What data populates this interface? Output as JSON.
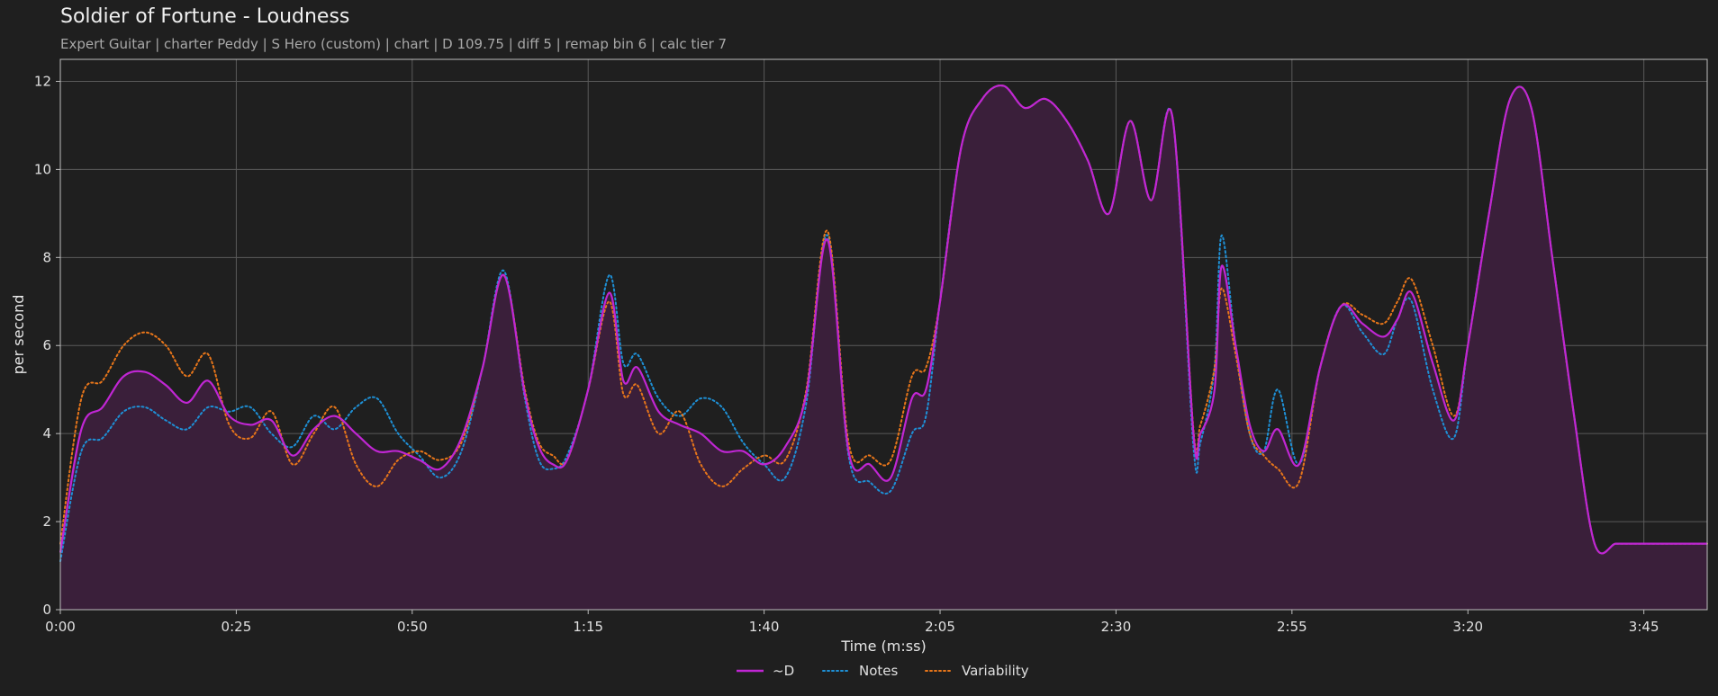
{
  "chart_data": {
    "type": "line",
    "title": "Soldier of Fortune - Loudness",
    "subtitle": "Expert Guitar  |  charter Peddy  |  S Hero (custom)  |  chart  |  D 109.75  |  diff 5  |  remap bin 6  |  calc tier 7",
    "xlabel": "Time (m:ss)",
    "ylabel": "per second",
    "xlim": [
      0,
      234
    ],
    "ylim": [
      0,
      12.5
    ],
    "xticks": [
      {
        "value": 0,
        "label": "0:00"
      },
      {
        "value": 25,
        "label": "0:25"
      },
      {
        "value": 50,
        "label": "0:50"
      },
      {
        "value": 75,
        "label": "1:15"
      },
      {
        "value": 100,
        "label": "1:40"
      },
      {
        "value": 125,
        "label": "2:05"
      },
      {
        "value": 150,
        "label": "2:30"
      },
      {
        "value": 175,
        "label": "2:55"
      },
      {
        "value": 200,
        "label": "3:20"
      },
      {
        "value": 225,
        "label": "3:45"
      }
    ],
    "yticks": [
      {
        "value": 0,
        "label": "0"
      },
      {
        "value": 2,
        "label": "2"
      },
      {
        "value": 4,
        "label": "4"
      },
      {
        "value": 6,
        "label": "6"
      },
      {
        "value": 8,
        "label": "8"
      },
      {
        "value": 10,
        "label": "10"
      },
      {
        "value": 12,
        "label": "12"
      }
    ],
    "grid": true,
    "legend_position": "bottom-center",
    "x": [
      0,
      3,
      6,
      9,
      12,
      15,
      18,
      21,
      24,
      27,
      30,
      33,
      36,
      39,
      42,
      45,
      48,
      51,
      54,
      57,
      60,
      63,
      66,
      68,
      70,
      72,
      75,
      78,
      80,
      82,
      85,
      88,
      91,
      94,
      97,
      100,
      103,
      106,
      109,
      112,
      115,
      118,
      121,
      123,
      125,
      128,
      131,
      134,
      137,
      140,
      143,
      146,
      149,
      152,
      155,
      158,
      161,
      162,
      164,
      165,
      167,
      169,
      171,
      173,
      176,
      179,
      182,
      185,
      188,
      190,
      192,
      195,
      198,
      200,
      203,
      206,
      209,
      212,
      215,
      218,
      221,
      223,
      226,
      229,
      232,
      234
    ],
    "series": [
      {
        "name": "~D",
        "color": "#c026d3",
        "style": "solid",
        "values": [
          1.3,
          4.1,
          4.6,
          5.3,
          5.4,
          5.1,
          4.7,
          5.2,
          4.4,
          4.2,
          4.3,
          3.5,
          4.1,
          4.4,
          4.0,
          3.6,
          3.6,
          3.4,
          3.2,
          3.9,
          5.5,
          7.6,
          4.9,
          3.7,
          3.3,
          3.4,
          5.0,
          7.2,
          5.2,
          5.5,
          4.5,
          4.2,
          4.0,
          3.6,
          3.6,
          3.3,
          3.7,
          4.9,
          8.4,
          3.6,
          3.3,
          3.0,
          4.8,
          5.0,
          7.0,
          10.5,
          11.6,
          11.9,
          11.4,
          11.6,
          11.1,
          10.2,
          9.0,
          11.1,
          9.3,
          11.2,
          4.0,
          4.0,
          5.0,
          7.8,
          6.0,
          4.2,
          3.6,
          4.1,
          3.3,
          5.5,
          6.9,
          6.5,
          6.2,
          6.6,
          7.2,
          5.6,
          4.3,
          6.0,
          9.0,
          11.6,
          11.4,
          8.0,
          4.5,
          1.5,
          1.5,
          1.5,
          1.5,
          1.5,
          1.5,
          1.5
        ]
      },
      {
        "name": "Notes",
        "color": "#1e90d6",
        "style": "dotted",
        "values": [
          1.1,
          3.6,
          3.9,
          4.5,
          4.6,
          4.3,
          4.1,
          4.6,
          4.5,
          4.6,
          4.0,
          3.7,
          4.4,
          4.1,
          4.6,
          4.8,
          4.0,
          3.5,
          3.0,
          3.6,
          5.5,
          7.7,
          4.8,
          3.4,
          3.2,
          3.5,
          5.0,
          7.6,
          5.6,
          5.8,
          4.8,
          4.4,
          4.8,
          4.6,
          3.8,
          3.3,
          3.0,
          4.7,
          8.5,
          3.5,
          2.9,
          2.7,
          4.0,
          4.4,
          7.0,
          10.5,
          11.6,
          11.9,
          11.4,
          11.6,
          11.1,
          10.2,
          9.0,
          11.1,
          9.3,
          11.2,
          3.7,
          3.8,
          5.5,
          8.5,
          6.0,
          4.0,
          3.6,
          5.0,
          3.3,
          5.5,
          6.9,
          6.3,
          5.8,
          6.6,
          7.0,
          5.0,
          3.9,
          6.0,
          9.0,
          11.6,
          11.4,
          8.0,
          4.5,
          1.5,
          1.5,
          1.5,
          1.5,
          1.5,
          1.5,
          1.5
        ]
      },
      {
        "name": "Variability",
        "color": "#e8761a",
        "style": "dotted",
        "values": [
          1.5,
          4.8,
          5.2,
          6.0,
          6.3,
          6.0,
          5.3,
          5.8,
          4.2,
          3.9,
          4.5,
          3.3,
          4.0,
          4.6,
          3.3,
          2.8,
          3.4,
          3.6,
          3.4,
          3.8,
          5.5,
          7.6,
          5.0,
          3.8,
          3.5,
          3.4,
          5.0,
          7.0,
          4.9,
          5.1,
          4.0,
          4.5,
          3.3,
          2.8,
          3.2,
          3.5,
          3.4,
          5.0,
          8.6,
          3.8,
          3.5,
          3.4,
          5.3,
          5.5,
          7.0,
          10.5,
          11.6,
          11.9,
          11.4,
          11.6,
          11.1,
          10.2,
          9.0,
          11.1,
          9.3,
          11.2,
          4.1,
          4.2,
          5.5,
          7.3,
          5.8,
          4.0,
          3.5,
          3.2,
          2.9,
          5.5,
          6.9,
          6.7,
          6.5,
          7.0,
          7.5,
          6.0,
          4.4,
          6.0,
          9.0,
          11.6,
          11.4,
          8.0,
          4.5,
          1.5,
          1.5,
          1.5,
          1.5,
          1.5,
          1.5,
          1.5
        ]
      }
    ],
    "fill_color": "#3a1f3a"
  }
}
